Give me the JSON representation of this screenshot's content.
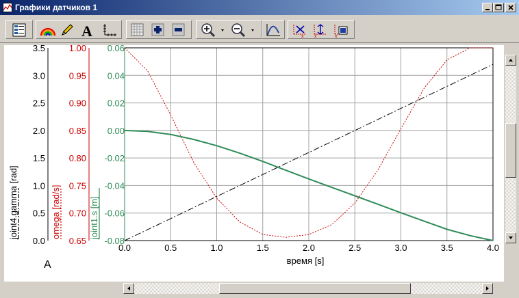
{
  "window": {
    "title": "Графики датчиков 1",
    "icons": [
      "app-icon",
      "minimize-icon",
      "maximize-icon",
      "close-icon"
    ]
  },
  "toolbar": {
    "icons": [
      "legend-icon",
      "rainbow-icon",
      "pencil-icon",
      "text-icon",
      "axis-icon",
      "grid-icon",
      "add-icon",
      "remove-icon",
      "zoom-in-icon",
      "zoom-out-icon",
      "fit-curve-icon",
      "x-scale-icon",
      "y-scale-icon",
      "export-icon"
    ]
  },
  "corner_label": "A",
  "colors": {
    "black": "#000000",
    "red": "#cc0000",
    "green": "#2e8b57"
  },
  "chart_data": {
    "type": "line",
    "xlabel": "время  [s]",
    "x_ticks": [
      "0.0",
      "0.5",
      "1.0",
      "1.5",
      "2.0",
      "2.5",
      "3.0",
      "3.5",
      "4.0"
    ],
    "xlim": [
      0,
      4
    ],
    "axes": [
      {
        "name": "joint4.gamma  [rad]",
        "color": "#000000",
        "ylim": [
          0,
          3.5
        ],
        "ticks": [
          "3.5",
          "3.0",
          "2.5",
          "2.0",
          "1.5",
          "1.0",
          "0.5",
          "0.0"
        ]
      },
      {
        "name": "omega  [rad/s]",
        "color": "#cc0000",
        "ylim": [
          0.65,
          1.0
        ],
        "ticks": [
          "1.00",
          "0.95",
          "0.90",
          "0.85",
          "0.80",
          "0.75",
          "0.70",
          "0.65"
        ]
      },
      {
        "name": "joint1.s  [m]",
        "color": "#2e8b57",
        "ylim": [
          -0.08,
          0.06
        ],
        "ticks": [
          "0.06",
          "0.04",
          "0.02",
          "0.00",
          "-0.02",
          "-0.04",
          "-0.06",
          "-0.08"
        ]
      }
    ],
    "series": [
      {
        "name": "joint4.gamma  [rad]",
        "axis": 0,
        "style": "dashdot",
        "x": [
          0,
          0.5,
          1,
          1.5,
          2,
          2.5,
          3,
          3.5,
          4
        ],
        "y": [
          0,
          0.4,
          0.8,
          1.2,
          1.6,
          2.0,
          2.4,
          2.8,
          3.2
        ]
      },
      {
        "name": "omega  [rad/s]",
        "axis": 1,
        "style": "dotted",
        "x": [
          0,
          0.25,
          0.5,
          0.75,
          1,
          1.25,
          1.5,
          1.75,
          2,
          2.25,
          2.5,
          2.75,
          3,
          3.25,
          3.5,
          3.75,
          4
        ],
        "y": [
          1.0,
          0.958,
          0.878,
          0.792,
          0.727,
          0.684,
          0.661,
          0.656,
          0.661,
          0.679,
          0.718,
          0.778,
          0.853,
          0.926,
          0.978,
          1.0,
          1.0
        ]
      },
      {
        "name": "joint1.s  [m]",
        "axis": 2,
        "style": "solid",
        "x": [
          0,
          0.25,
          0.5,
          0.75,
          1,
          1.25,
          1.5,
          1.75,
          2,
          2.25,
          2.5,
          2.75,
          3,
          3.25,
          3.5,
          3.75,
          4
        ],
        "y": [
          0.0,
          -0.0007,
          -0.0029,
          -0.0065,
          -0.0111,
          -0.0165,
          -0.0225,
          -0.0289,
          -0.0352,
          -0.0414,
          -0.0475,
          -0.0536,
          -0.0598,
          -0.0658,
          -0.0718,
          -0.0764,
          -0.08
        ]
      }
    ],
    "grid": true
  }
}
